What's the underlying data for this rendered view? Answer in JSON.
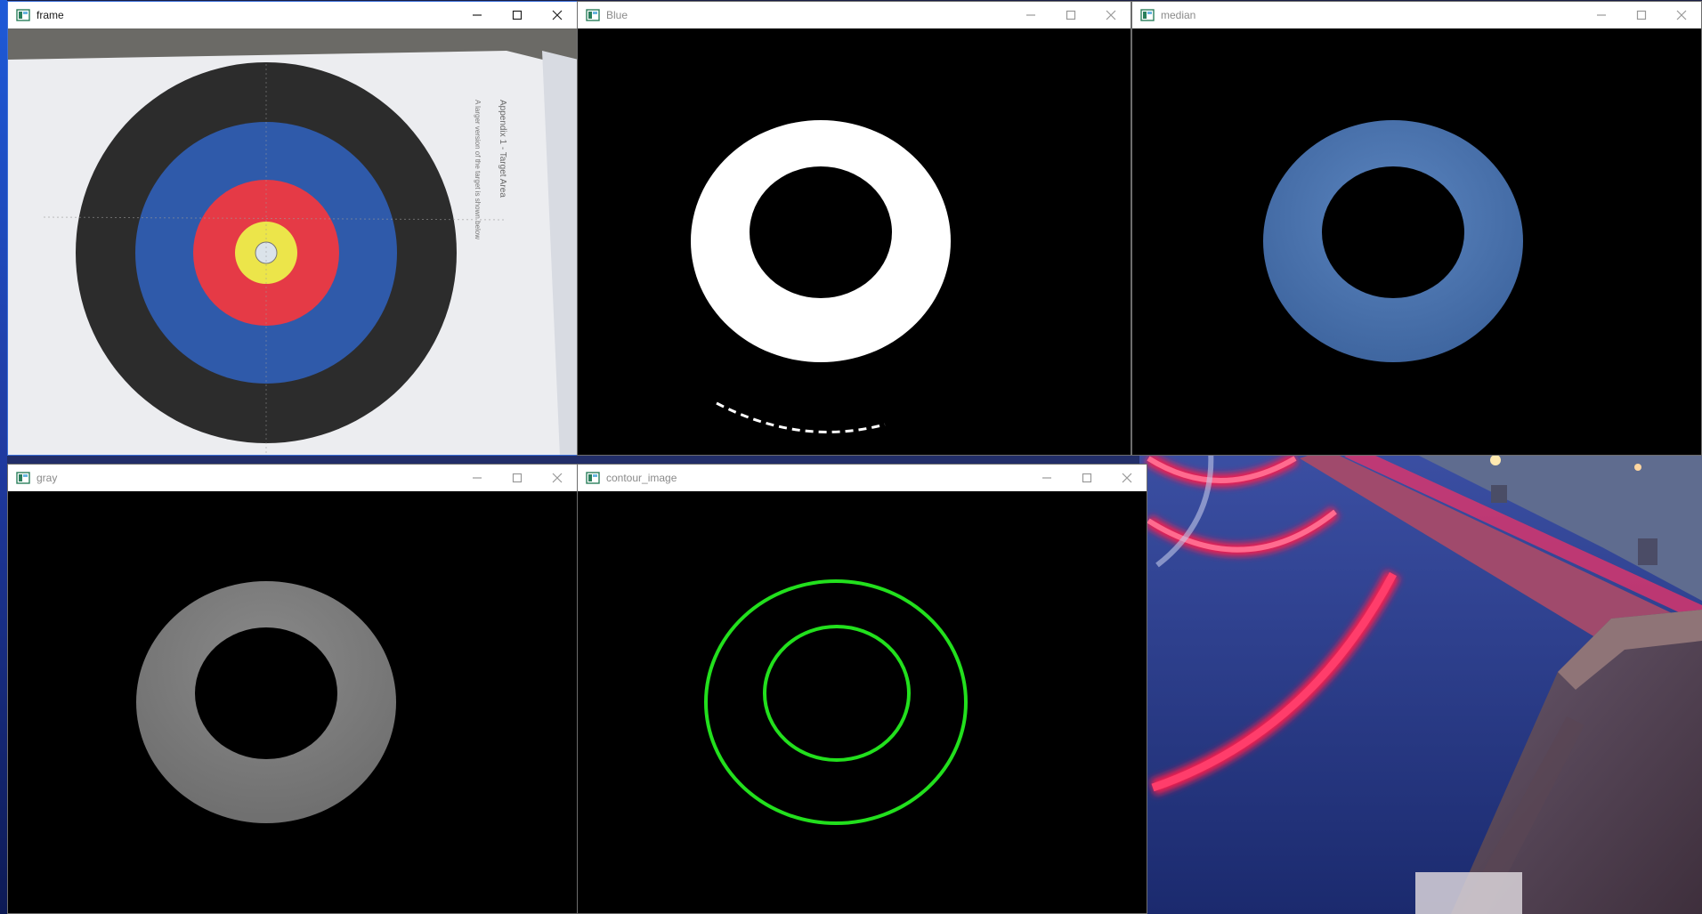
{
  "windows": {
    "frame": {
      "title": "frame",
      "page_text_1": "Appendix 1 - Target Area",
      "page_text_2": "A larger version of the target is shown below"
    },
    "blue": {
      "title": "Blue"
    },
    "median": {
      "title": "median"
    },
    "gray": {
      "title": "gray"
    },
    "contour": {
      "title": "contour_image"
    }
  },
  "icons": {
    "app": "opencv-window-icon",
    "minimize": "minimize-icon",
    "maximize": "maximize-icon",
    "close": "close-icon"
  },
  "colors": {
    "contour_green": "#22e01d",
    "median_blue": "#4a74ad",
    "gray_ring": "#7e7e7e",
    "target_black": "#2c2c2c",
    "target_blue": "#2f5aaa",
    "target_red": "#e53a46",
    "target_yellow": "#ece54a",
    "wallpaper_neon": "#ff1744"
  }
}
